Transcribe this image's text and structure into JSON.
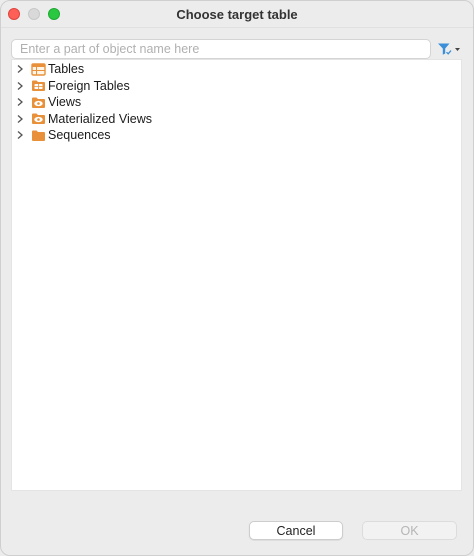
{
  "window": {
    "title": "Choose target table"
  },
  "search": {
    "placeholder": "Enter a part of object name here",
    "value": ""
  },
  "filter": {
    "icon": "filter-icon",
    "dropdown_icon": "caret-down-icon"
  },
  "tree": {
    "items": [
      {
        "label": "Tables",
        "icon": "table-icon"
      },
      {
        "label": "Foreign Tables",
        "icon": "foreign-table-folder-icon"
      },
      {
        "label": "Views",
        "icon": "view-folder-icon"
      },
      {
        "label": "Materialized Views",
        "icon": "materialized-view-folder-icon"
      },
      {
        "label": "Sequences",
        "icon": "folder-icon"
      }
    ]
  },
  "buttons": {
    "cancel": "Cancel",
    "ok": "OK"
  },
  "colors": {
    "accent_orange": "#e8913a",
    "filter_blue": "#3a8fd8",
    "disabled_text": "#b5b5b5"
  }
}
